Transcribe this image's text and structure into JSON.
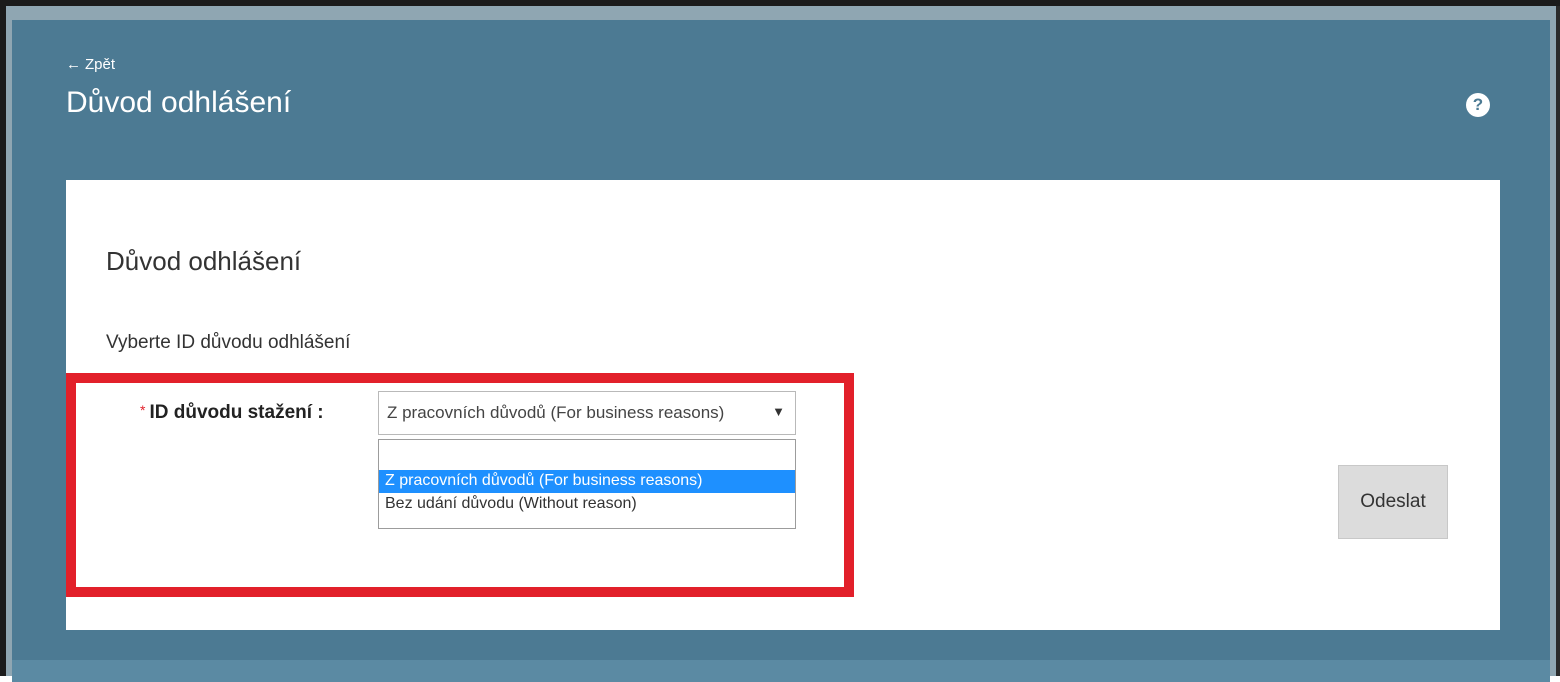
{
  "header": {
    "back_label": "Zpět",
    "back_arrow": "←",
    "title": "Důvod odhlášení",
    "help_icon": "?"
  },
  "card": {
    "title": "Důvod odhlášení",
    "subtitle": "Vyberte ID důvodu odhlášení",
    "field": {
      "required_marker": "*",
      "label": "ID důvodu stažení :",
      "selected_value": "Z pracovních důvodů (For business reasons)",
      "caret": "▼",
      "options": [
        "",
        "Z pracovních důvodů (For business reasons)",
        "Bez udání důvodu (Without reason)"
      ]
    },
    "submit_label": "Odeslat"
  },
  "colors": {
    "header_bg": "#4c7a93",
    "highlight": "#e2202a",
    "selected_option": "#1e90ff"
  }
}
